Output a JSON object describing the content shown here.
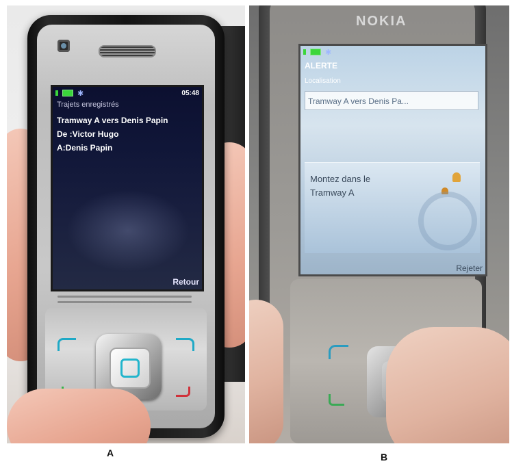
{
  "panels": [
    {
      "label": "A",
      "screen": {
        "time": "05:48",
        "lines": [
          "Trajets enregistrés",
          "Tramway A vers Denis Papin",
          "De :Victor Hugo",
          "A:Denis Papin"
        ],
        "softkey_right": "Retour"
      }
    },
    {
      "label": "B",
      "brand": "NOKIA",
      "screen": {
        "title": "ALERTE",
        "subtitle": "Localisation",
        "field_value": "Tramway A vers Denis Pa...",
        "popup_lines": [
          "Montez dans le",
          "Tramway A"
        ],
        "softkey_right": "Rejeter"
      }
    }
  ],
  "colors": {
    "screen_a_bg": "#101638",
    "screen_b_bg": "#d7e4ee",
    "nav_accent": "#22b5cc",
    "call_green": "#36b34a",
    "end_red": "#d0313a"
  },
  "icons": [
    "camera-icon",
    "battery-icon",
    "signal-icon",
    "bluetooth-icon",
    "bell-icon",
    "call-key-icon",
    "end-key-icon",
    "dpad-icon"
  ]
}
